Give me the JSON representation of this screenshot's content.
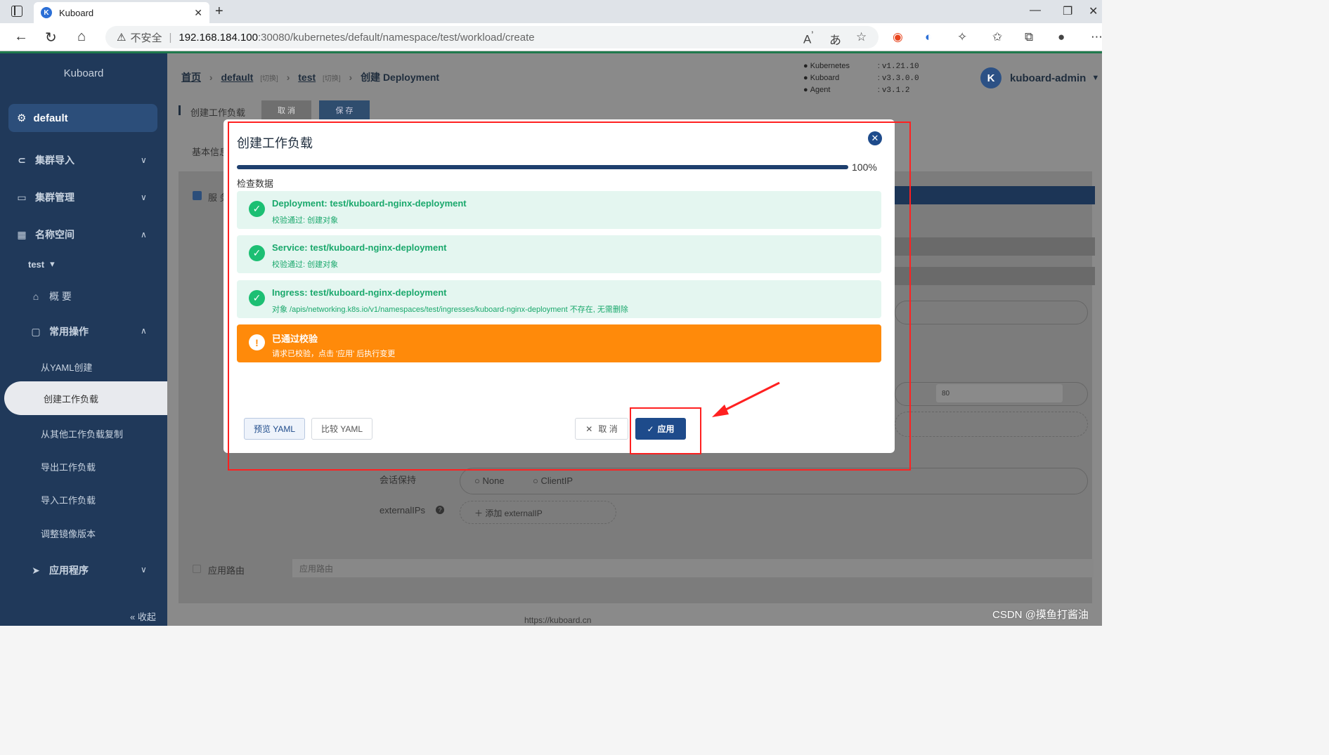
{
  "browser": {
    "tab_title": "Kuboard",
    "tab_favicon_letter": "K",
    "url_insecure": "不安全",
    "url_host": "192.168.184.100",
    "url_path": ":30080/kubernetes/default/namespace/test/workload/create"
  },
  "sidebar": {
    "logo": "Kuboard",
    "namespace": "default",
    "items": {
      "cluster_import": "集群导入",
      "cluster_manage": "集群管理",
      "namespace": "名称空间",
      "ns_selected": "test",
      "overview": "概 要",
      "common_ops": "常用操作",
      "from_yaml": "从YAML创建",
      "create_workload": "创建工作负载",
      "copy_workload": "从其他工作负载复制",
      "export_workload": "导出工作负载",
      "import_workload": "导入工作负载",
      "adjust_image": "调整镜像版本",
      "applications": "应用程序"
    },
    "collapse": "收起"
  },
  "background": {
    "breadcrumb": {
      "home": "首页",
      "ns": "default",
      "switch1": "[切换]",
      "sub": "test",
      "switch2": "[切换]",
      "current": "创建 Deployment"
    },
    "versions": {
      "k8s_label": "Kubernetes",
      "k8s_value": "v1.21.10",
      "kuboard_label": "Kuboard",
      "kuboard_value": "v3.3.0.0",
      "agent_label": "Agent",
      "agent_value": "v3.1.2"
    },
    "user": "kuboard-admin",
    "toolbar_title": "创建工作负载",
    "toolbar_cancel": "取 消",
    "toolbar_save": "保 存",
    "tab_basic": "基本信息",
    "service_checkbox": "服 务",
    "session_label": "会话保持",
    "session_none": "None",
    "session_clientip": "ClientIP",
    "external_ips_label": "externalIPs",
    "add_external_ip": "添加 externalIP",
    "port_value": "80",
    "route_label": "应用路由",
    "route_placeholder": "应用路由",
    "footer": "https://kuboard.cn"
  },
  "modal": {
    "title": "创建工作负载",
    "progress_percent": 100,
    "progress_text": "100%",
    "check_label": "检查数据",
    "alerts": [
      {
        "type": "success",
        "title": "Deployment: test/kuboard-nginx-deployment",
        "desc": "校验通过: 创建对象"
      },
      {
        "type": "success",
        "title": "Service: test/kuboard-nginx-deployment",
        "desc": "校验通过: 创建对象"
      },
      {
        "type": "success",
        "title": "Ingress: test/kuboard-nginx-deployment",
        "desc": "对象 /apis/networking.k8s.io/v1/namespaces/test/ingresses/kuboard-nginx-deployment 不存在, 无需删除"
      },
      {
        "type": "warning",
        "title": "已通过校验",
        "desc": "请求已校验，点击 '应用' 后执行变更"
      }
    ],
    "buttons": {
      "preview_yaml": "预览 YAML",
      "compare_yaml": "比较 YAML",
      "cancel": "取 消",
      "apply": "应用"
    }
  },
  "watermark": "CSDN @摸鱼打酱油",
  "colors": {
    "sidebar": "#20395a",
    "primary": "#1e4b8b",
    "success": "#1cbf73",
    "warning": "#ff8a0a",
    "annotation": "#ff2020"
  }
}
